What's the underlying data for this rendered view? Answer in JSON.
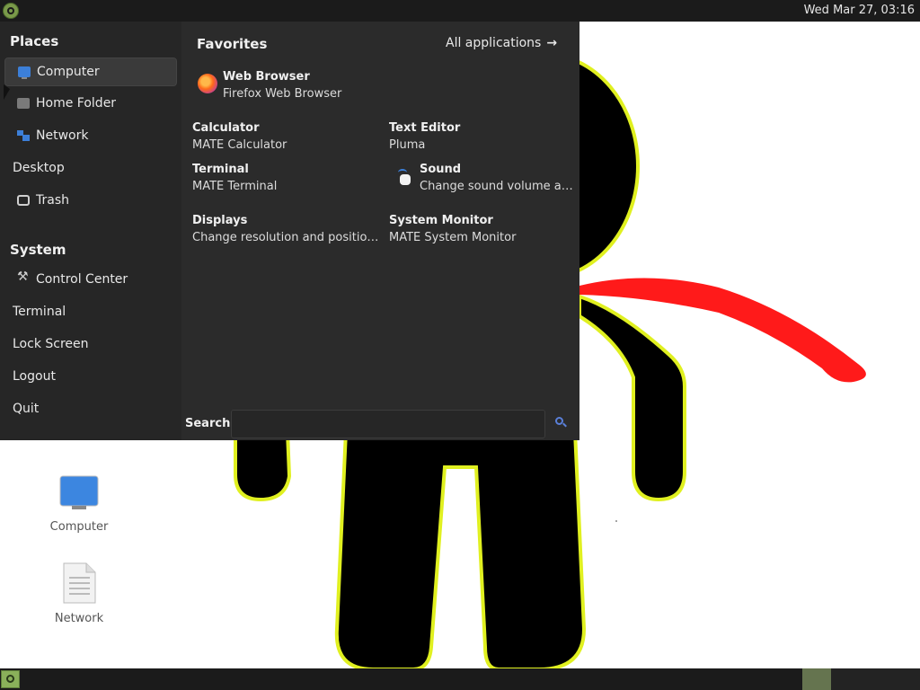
{
  "top_panel": {
    "clock": "Wed Mar 27, 03:16"
  },
  "menu": {
    "places": {
      "title": "Places",
      "items": [
        {
          "label": "Computer",
          "icon": "computer-icon"
        },
        {
          "label": "Home Folder",
          "icon": "folder-icon"
        },
        {
          "label": "Network",
          "icon": "network-icon"
        },
        {
          "label": "Desktop"
        },
        {
          "label": "Trash",
          "icon": "trash-icon"
        }
      ]
    },
    "system": {
      "title": "System",
      "items": [
        {
          "label": "Control Center",
          "icon": "tools-icon"
        },
        {
          "label": "Terminal"
        },
        {
          "label": "Lock Screen"
        },
        {
          "label": "Logout"
        },
        {
          "label": "Quit"
        }
      ]
    },
    "favorites": {
      "title": "Favorites",
      "all_applications": "All applications",
      "items": [
        {
          "name": "Web Browser",
          "desc": "Firefox Web Browser",
          "icon": "firefox-icon"
        },
        {
          "name": "Calculator",
          "desc": "MATE Calculator"
        },
        {
          "name": "Text Editor",
          "desc": "Pluma"
        },
        {
          "name": "Terminal",
          "desc": "MATE Terminal"
        },
        {
          "name": "Sound",
          "desc": "Change sound volume a…",
          "icon": "speaker-icon"
        },
        {
          "name": "Displays",
          "desc": "Change resolution and positio…"
        },
        {
          "name": "System Monitor",
          "desc": "MATE System Monitor"
        }
      ]
    },
    "search": {
      "label": "Search:",
      "value": "",
      "placeholder": ""
    }
  },
  "desktop": {
    "icons": [
      {
        "label": "Computer",
        "icon": "monitor-icon"
      },
      {
        "label": "Network",
        "icon": "document-icon"
      }
    ]
  },
  "colors": {
    "panel_bg": "#1b1b1b",
    "menu_bg": "#2b2b2b",
    "accent_green": "#8ab05a",
    "figure_outline": "#e0f020",
    "figure_arm": "#ff1a1a"
  }
}
